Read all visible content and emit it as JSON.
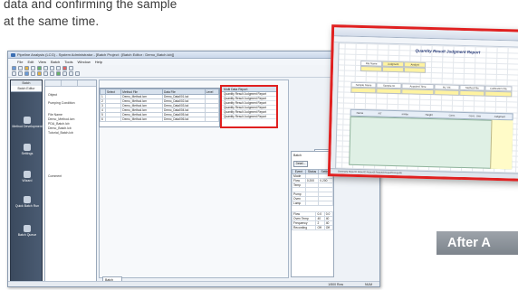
{
  "caption": {
    "line1": "data and confirming the sample",
    "line2": "at the same time."
  },
  "app": {
    "title": "Pipeline Analysis (LCG) - System Administrator - [Batch Project : [Batch Editor : Demo_Batch.lcb]]",
    "menu": [
      "File",
      "Edit",
      "View",
      "Batch",
      "Tools",
      "Window",
      "Help"
    ],
    "nav": {
      "header": "Batch",
      "selected": "Batch Editor",
      "items": [
        "Method Development",
        "Settings",
        "Wizard",
        "Quick Batch Run",
        "Batch Queue"
      ]
    },
    "tree": {
      "items": [
        "Object",
        "Pumping Condition",
        "File Name"
      ],
      "files": [
        "Demo_Method.lcm",
        "PDA_Batch.lcb",
        "Demo_Batch.lcb",
        "Tutorial_Batch.lcb"
      ],
      "comment_label": "Comment"
    },
    "grid": {
      "headers": [
        "",
        "Select",
        "Method File",
        "Data File",
        "Level"
      ],
      "rows": [
        [
          "1",
          "",
          "Demo_Method.lcm",
          "Demo_Data001.lcd",
          ""
        ],
        [
          "2",
          "",
          "Demo_Method.lcm",
          "Demo_Data002.lcd",
          ""
        ],
        [
          "3",
          "",
          "Demo_Method.lcm",
          "Demo_Data003.lcd",
          ""
        ],
        [
          "4",
          "",
          "Demo_Method.lcm",
          "Demo_Data004.lcd",
          ""
        ],
        [
          "5",
          "",
          "Demo_Method.lcm",
          "Demo_Data005.lcd",
          ""
        ],
        [
          "6",
          "",
          "Demo_Method.lcm",
          "Demo_Data006.lcd",
          ""
        ]
      ]
    },
    "highlight_column": {
      "header": "Multi Data Report",
      "rows": [
        "Quantity Result Judgment Report",
        "Quantity Result Judgment Report",
        "Quantity Result Judgment Report",
        "Quantity Result Judgment Report",
        "Quantity Result Judgment Report",
        "Quantity Result Judgment Report"
      ]
    },
    "side_panel": {
      "label": "Batch",
      "button": "Detail...",
      "headers": [
        "Event",
        "Status",
        "Setting"
      ],
      "rows": [
        [
          "Mode",
          "",
          ""
        ],
        [
          "Flow",
          "0.200",
          "0.200"
        ],
        [
          "Temp",
          "",
          ""
        ],
        [
          "",
          "",
          ""
        ],
        [
          "Pump",
          "",
          ""
        ],
        [
          "Oven",
          "",
          ""
        ],
        [
          "Lamp",
          "",
          ""
        ]
      ],
      "summary": [
        [
          "Flow",
          "0.0",
          "0.0"
        ],
        [
          "Oven Temp",
          "40",
          "40"
        ],
        [
          "Frequency",
          "2",
          "40"
        ],
        [
          "Recording",
          "Off",
          "Off"
        ]
      ]
    },
    "bottom_tab": "Batch Table",
    "status": {
      "left": "1/500 Row",
      "right": "NUM"
    }
  },
  "sheet": {
    "title": "Quantity Result Judgment Report",
    "block1_cells": [
      "File Name",
      "Judgment",
      "Analyst"
    ],
    "block2_cells": [
      "Sample Name",
      "Sample ID",
      "Acquired Time",
      "Inj. Vol.",
      "Method File",
      "Calibration File"
    ],
    "big_headers": [
      "Name",
      "RT",
      "mAbs",
      "Height",
      "Conc.",
      "Conc. Unit",
      "Judgment"
    ],
    "tabs": "Summary  Report1  Report2  Report3  Report4  Report5  Report6"
  },
  "after_label": "After A",
  "colors": {
    "highlight": "#e02020",
    "nav": "#3b4a5e",
    "after_bg": "#8d939a"
  }
}
